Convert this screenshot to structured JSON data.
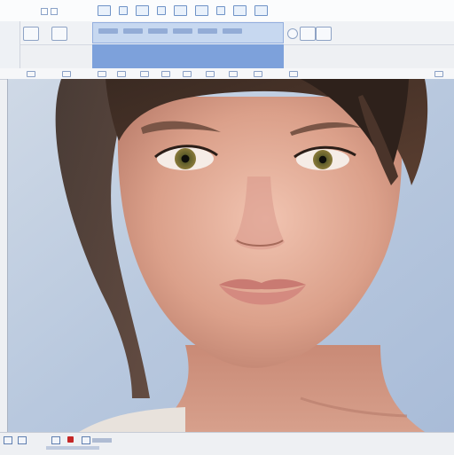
{
  "window": {
    "title": ""
  },
  "toolbar": {
    "buttons": [
      "back",
      "forward",
      "view",
      "grid",
      "settings",
      "help"
    ]
  },
  "address_bar": {
    "value": ""
  },
  "canvas": {
    "subject": "portrait"
  },
  "status_bar": {
    "text": ""
  },
  "colors": {
    "selection_blue": "#7da1db",
    "status_red": "#c42727"
  }
}
